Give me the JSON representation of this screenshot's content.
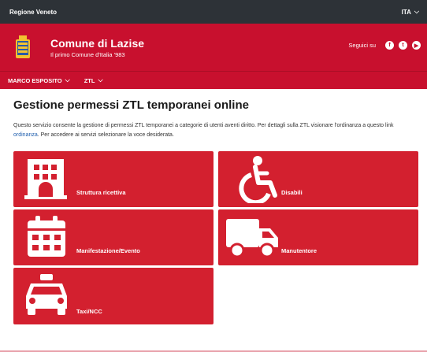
{
  "topbar": {
    "region": "Regione Veneto",
    "language": "ITA"
  },
  "header": {
    "title": "Comune di Lazise",
    "subtitle": "Il primo Comune d'Italia '983",
    "follow_label": "Seguici su",
    "social": [
      "facebook-icon",
      "twitter-icon",
      "youtube-icon"
    ]
  },
  "nav": {
    "items": [
      {
        "label": "MARCO ESPOSITO"
      },
      {
        "label": "ZTL"
      }
    ]
  },
  "main": {
    "title": "Gestione permessi ZTL temporanei online",
    "description_part1": "Questo servizio consente la gestione di permessi ZTL temporanei a categorie di utenti aventi diritto. Per dettagli sulla ZTL visionare l'ordinanza a questo link ",
    "description_link": "ordinanza",
    "description_part2": ". Per accedere ai servizi selezionare la voce desiderata.",
    "cards": [
      {
        "label": "Struttura ricettiva",
        "icon": "building-icon"
      },
      {
        "label": "Disabili",
        "icon": "wheelchair-icon"
      },
      {
        "label": "Manifestazione/Evento",
        "icon": "calendar-icon"
      },
      {
        "label": "Manutentore",
        "icon": "truck-icon"
      },
      {
        "label": "Taxi/NCC",
        "icon": "taxi-icon"
      }
    ]
  },
  "colors": {
    "primary": "#c8102e",
    "card": "#d3202f",
    "topbar": "#2d3237"
  }
}
